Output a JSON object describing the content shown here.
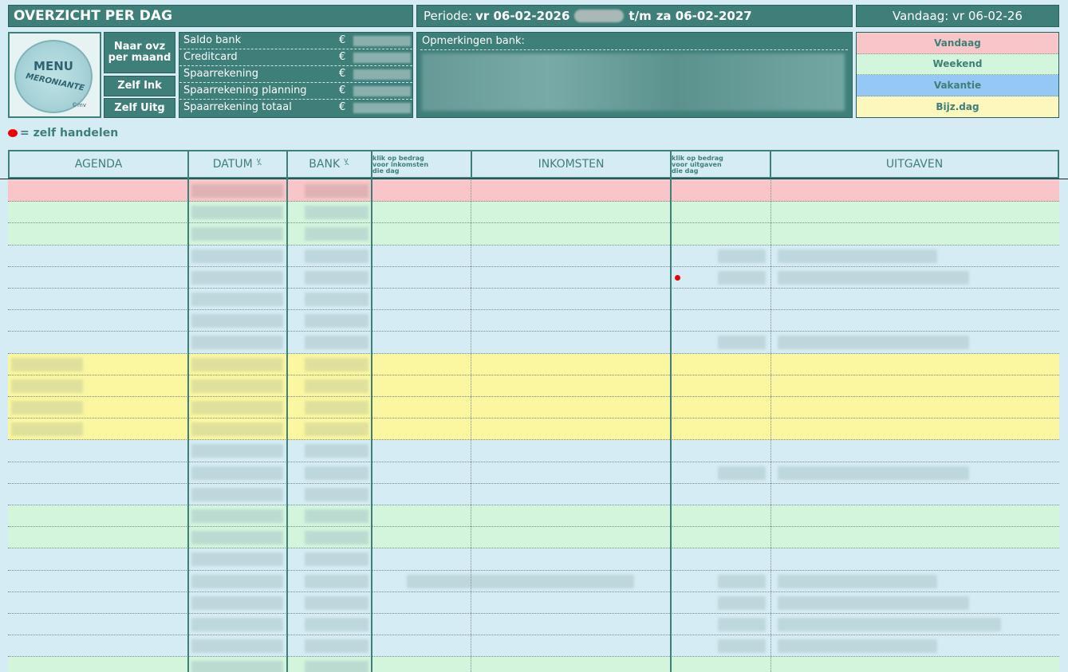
{
  "header": {
    "title": "OVERZICHT PER DAG",
    "period_prefix": "Periode: ",
    "period_start": "vr 06-02-2026",
    "period_mid": "t/m",
    "period_end": "za 06-02-2027",
    "today": "Vandaag: vr 06-02-26"
  },
  "logo": {
    "text": "MENU",
    "sub": "MERONIANTE",
    "copy": "©mv"
  },
  "nav": {
    "maand_line1": "Naar ovz",
    "maand_line2": "per maand",
    "zelf_ink": "Zelf Ink",
    "zelf_uitg": "Zelf Uitg"
  },
  "saldo": {
    "currency": "€",
    "rows": [
      "Saldo bank",
      "Creditcard",
      "Spaarrekening",
      "Spaarrekening planning",
      "Spaarrekening totaal"
    ]
  },
  "opmerkingen": {
    "label": "Opmerkingen bank:"
  },
  "legend": {
    "items": [
      {
        "label": "Vandaag",
        "color": "#f8c6c8"
      },
      {
        "label": "Weekend",
        "color": "#d2f5dc"
      },
      {
        "label": "Vakantie",
        "color": "#96c8f5"
      },
      {
        "label": "Bijz.dag",
        "color": "#fbf7bd"
      }
    ]
  },
  "zelf_handelen": "= zelf handelen",
  "columns": {
    "agenda": "AGENDA",
    "datum": "DATUM",
    "bank": "BANK",
    "klik_ink_1": "klik op bedrag",
    "klik_ink_2": "voor inkomsten",
    "klik_ink_3": "die dag",
    "inkomsten": "INKOMSTEN",
    "klik_uit_1": "klik op bedrag",
    "klik_uit_2": "voor uitgaven",
    "klik_uit_3": "die dag",
    "uitgaven": "UITGAVEN",
    "sort_up": "v",
    "sort_down": "^"
  },
  "row_colors": {
    "today": "#f8c6c8",
    "weekend": "#d2f5dc",
    "normal": "#d6ecf4",
    "special": "#fbf7a0"
  },
  "rows": [
    "today",
    "weekend",
    "weekend",
    "normal",
    "normal",
    "normal",
    "normal",
    "normal",
    "special",
    "special",
    "special",
    "special",
    "normal",
    "normal",
    "normal",
    "weekend",
    "weekend",
    "normal",
    "normal",
    "normal",
    "normal",
    "normal",
    "weekend"
  ]
}
